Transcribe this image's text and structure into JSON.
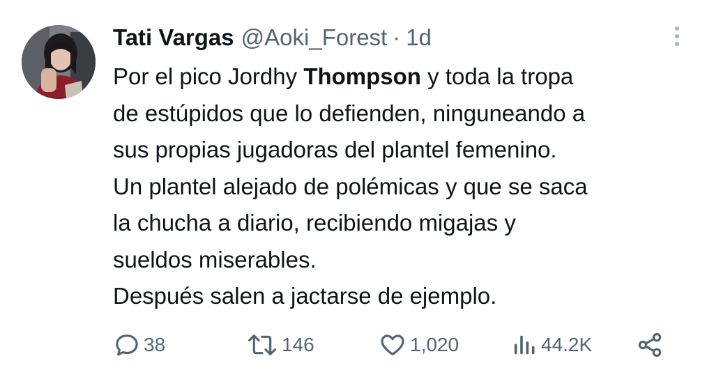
{
  "tweet": {
    "author": {
      "display_name": "Tati Vargas",
      "handle": "@Aoki_Forest",
      "separator": "·",
      "time": "1d"
    },
    "body_lines": [
      {
        "pre": "Por el pico Jordhy ",
        "bold": "Thompson",
        "post": " y toda la tropa"
      },
      {
        "text": "de estúpidos que lo defienden, ninguneando a"
      },
      {
        "text": "sus propias jugadoras del plantel femenino."
      },
      {
        "text": "Un plantel alejado de polémicas y que se saca"
      },
      {
        "text": "la chucha a diario, recibiendo migajas y"
      },
      {
        "text": "sueldos miserables."
      },
      {
        "text": "Después salen a jactarse de ejemplo."
      }
    ],
    "metrics": {
      "replies": "38",
      "retweets": "146",
      "likes": "1,020",
      "views": "44.2K"
    }
  },
  "icons": {
    "reply": "reply-icon",
    "retweet": "retweet-icon",
    "like": "heart-icon",
    "views": "views-icon",
    "share": "share-icon",
    "more": "more-icon"
  },
  "colors": {
    "text_primary": "#0f1419",
    "text_secondary": "#536471",
    "more_dots": "#a8b3bd"
  }
}
